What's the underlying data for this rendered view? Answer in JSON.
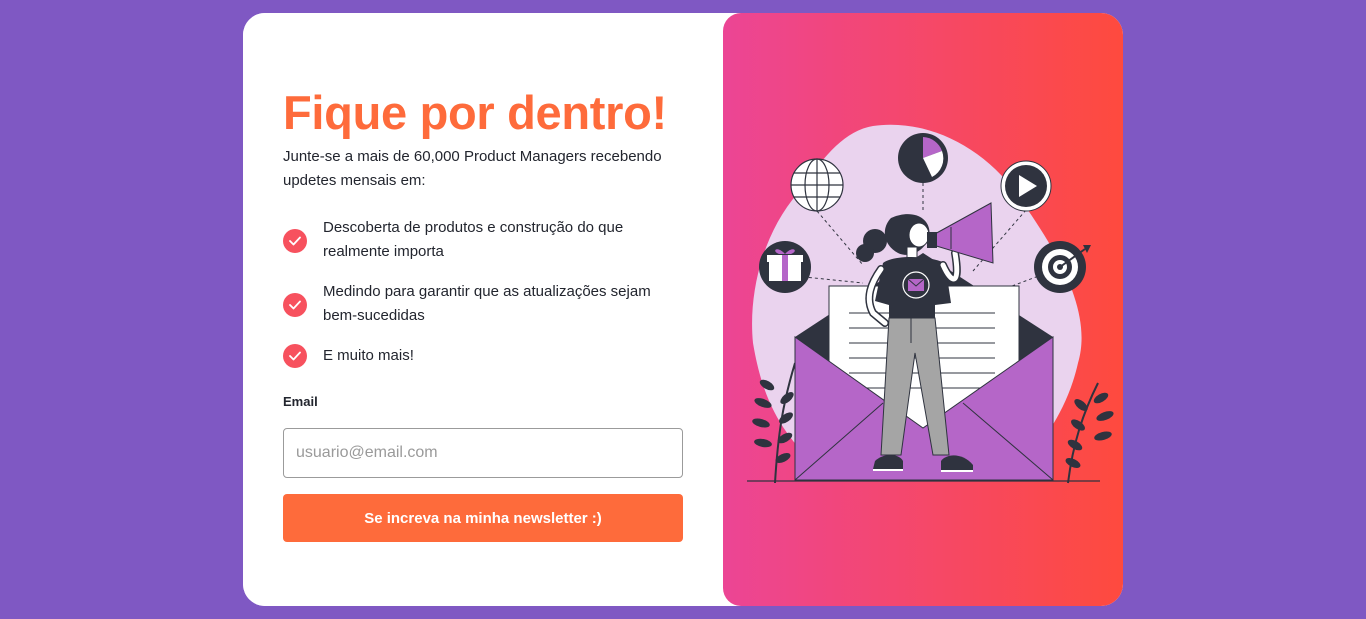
{
  "signup": {
    "title": "Fique por dentro!",
    "subtitle": "Junte-se a mais de 60,000 Product Managers recebendo updetes mensais em:",
    "benefits": [
      {
        "text": "Descoberta de produtos e construção do que realmente importa"
      },
      {
        "text": "Medindo para garantir que as atualizações sejam bem-sucedidas"
      },
      {
        "text": "E muito mais!"
      }
    ],
    "email_label": "Email",
    "email_placeholder": "usuario@email.com",
    "email_value": "",
    "submit_label": "Se increva na minha newsletter :)"
  },
  "illustration": {
    "icons": [
      "globe-icon",
      "pie-chart-icon",
      "play-icon",
      "gift-icon",
      "target-icon",
      "megaphone-icon",
      "envelope-icon"
    ]
  },
  "colors": {
    "page_background": "#7f58c3",
    "accent": "#fe6b3b",
    "check": "#f7515e",
    "gradient_start": "#ec4595",
    "gradient_end": "#fe4a3e",
    "illustration_purple": "#b566c8"
  }
}
